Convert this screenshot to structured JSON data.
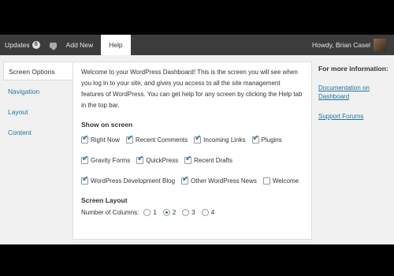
{
  "adminbar": {
    "updates_label": "Updates",
    "updates_count": "0",
    "add_new_label": "Add New",
    "help_label": "Help",
    "howdy_text": "Howdy, Brian Casel"
  },
  "help_tabs": [
    "Screen Options",
    "Navigation",
    "Layout",
    "Content"
  ],
  "content": {
    "intro": "Welcome to your WordPress Dashboard! This is the screen you will see when you log in to your site, and gives you access to all the site management features of WordPress. You can get help for any screen by clicking the Help tab in the top bar.",
    "show_on_screen_title": "Show on screen",
    "checkboxes": [
      {
        "label": "Right Now",
        "checked": true
      },
      {
        "label": "Recent Comments",
        "checked": true
      },
      {
        "label": "Incoming Links",
        "checked": true
      },
      {
        "label": "Plugins",
        "checked": true
      },
      {
        "label": "Gravity Forms",
        "checked": true
      },
      {
        "label": "QuickPress",
        "checked": true
      },
      {
        "label": "Recent Drafts",
        "checked": true
      },
      {
        "label": "WordPress Development Blog",
        "checked": true
      },
      {
        "label": "Other WordPress News",
        "checked": true
      },
      {
        "label": "Welcome",
        "checked": false
      }
    ],
    "screen_layout_title": "Screen Layout",
    "columns_label": "Number of Columns:",
    "columns_options": [
      "1",
      "2",
      "3",
      "4"
    ],
    "columns_selected": "2"
  },
  "sidebar": {
    "title": "For more information:",
    "link1": "Documentation on Dashboard",
    "link2": "Support Forums"
  },
  "colors": {
    "link": "#21759b",
    "adminbar": "#3c3c3c"
  }
}
